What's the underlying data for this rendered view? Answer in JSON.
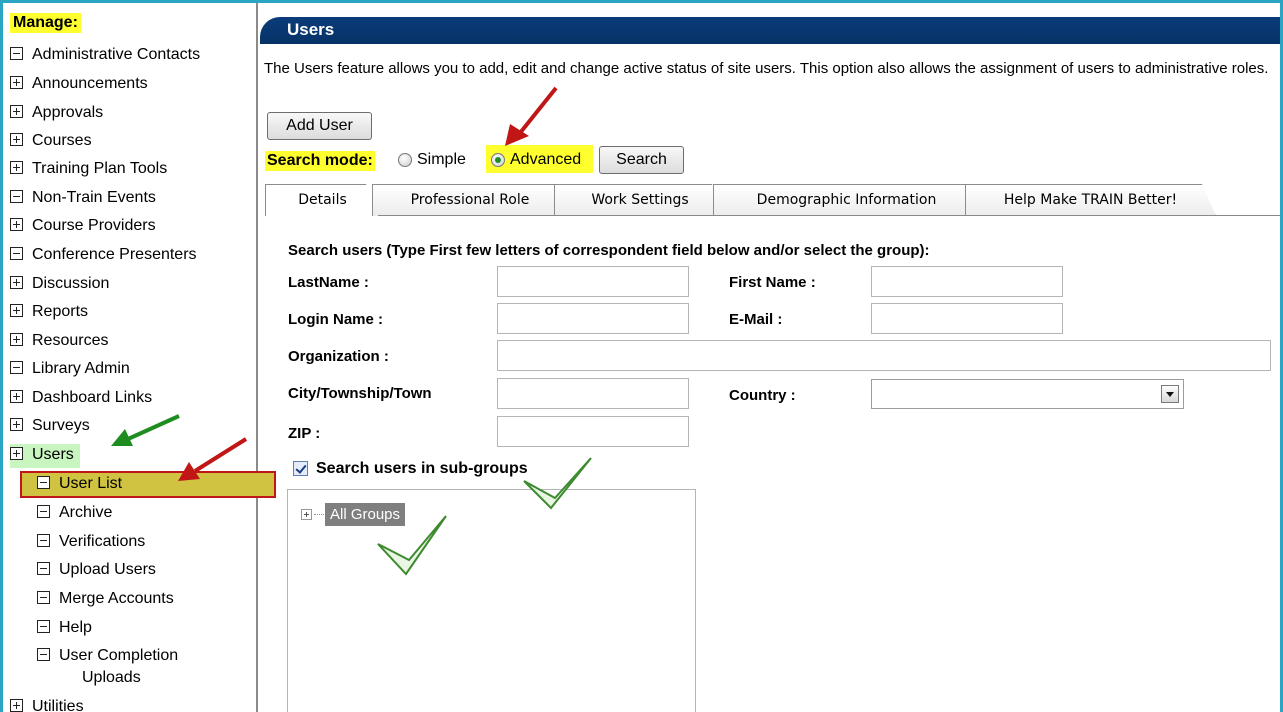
{
  "sidebar": {
    "manage_label": "Manage:",
    "items": [
      {
        "label": "Administrative Contacts",
        "icon": "minus-box-icon"
      },
      {
        "label": "Announcements",
        "icon": "plus-box-icon"
      },
      {
        "label": "Approvals",
        "icon": "plus-box-icon"
      },
      {
        "label": "Courses",
        "icon": "plus-box-icon"
      },
      {
        "label": "Training Plan Tools",
        "icon": "plus-box-icon"
      },
      {
        "label": "Non-Train Events",
        "icon": "minus-box-icon"
      },
      {
        "label": "Course Providers",
        "icon": "plus-box-icon"
      },
      {
        "label": "Conference Presenters",
        "icon": "minus-box-icon"
      },
      {
        "label": "Discussion",
        "icon": "plus-box-icon"
      },
      {
        "label": "Reports",
        "icon": "plus-box-icon"
      },
      {
        "label": "Resources",
        "icon": "plus-box-icon"
      },
      {
        "label": "Library Admin",
        "icon": "minus-box-icon"
      },
      {
        "label": "Dashboard Links",
        "icon": "plus-box-icon"
      },
      {
        "label": "Surveys",
        "icon": "plus-box-icon"
      },
      {
        "label": "Users",
        "icon": "plus-box-icon"
      }
    ],
    "users_subitems": [
      {
        "label": "User List"
      },
      {
        "label": "Archive"
      },
      {
        "label": "Verifications"
      },
      {
        "label": "Upload Users"
      },
      {
        "label": "Merge Accounts"
      },
      {
        "label": "Help"
      },
      {
        "label": "User Completion",
        "label2": "Uploads"
      }
    ],
    "last_item": {
      "label": "Utilities",
      "icon": "plus-box-icon"
    }
  },
  "header": {
    "title": "Users"
  },
  "description": "The Users feature allows you to add, edit and change active status of site users. This option also allows the assignment of users to administrative roles.",
  "buttons": {
    "add_user": "Add User",
    "search": "Search"
  },
  "search_mode": {
    "label": "Search mode:",
    "options": [
      "Simple",
      "Advanced"
    ],
    "selected": "Advanced"
  },
  "tabs": [
    "Details",
    "Professional Role",
    "Work Settings",
    "Demographic Information",
    "Help Make TRAIN Better!"
  ],
  "active_tab": "Details",
  "form": {
    "heading": "Search users (Type First few letters of correspondent field below and/or select the group):",
    "labels": {
      "last_name": "LastName :",
      "first_name": "First Name :",
      "login_name": "Login Name :",
      "email": "E-Mail :",
      "organization": "Organization :",
      "city": "City/Township/Town",
      "country": "Country :",
      "zip": "ZIP :"
    },
    "values": {
      "last_name": "",
      "first_name": "",
      "login_name": "",
      "email": "",
      "organization": "",
      "city": "",
      "country": "",
      "zip": ""
    },
    "subgroups_label": "Search users in sub-groups",
    "subgroups_checked": true
  },
  "tree": {
    "root": "All Groups"
  },
  "colors": {
    "highlight_yellow": "#ffff2e",
    "header_blue": "#063266",
    "frame_teal": "#2aa6c4",
    "arrow_red": "#c01616",
    "arrow_green": "#1f8c1f",
    "users_highlight": "#c8f5c0",
    "user_list_highlight": "#cfc341"
  }
}
